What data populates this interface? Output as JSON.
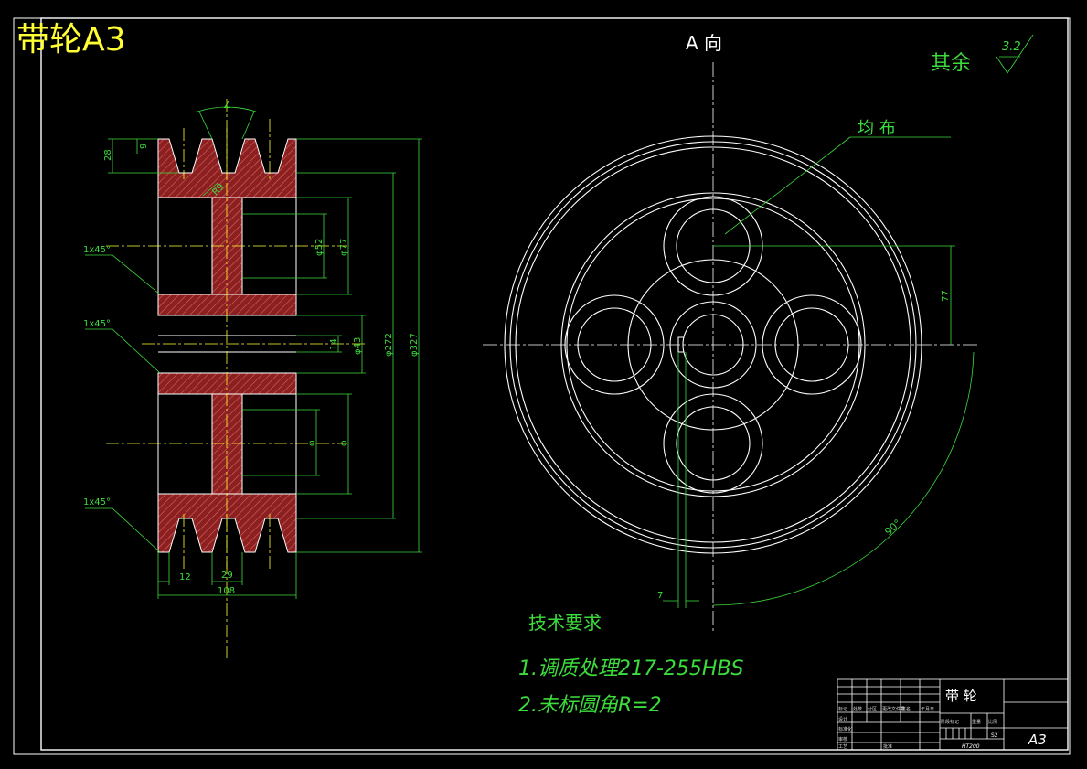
{
  "title": "带轮A3",
  "view_label": "A 向",
  "surface_roughness": {
    "label": "其余",
    "value": "3.2"
  },
  "distribution_label": "均 布",
  "section_dimensions": {
    "groove_angle": "∠",
    "groove_top": "9",
    "groove_depth": "28",
    "fillet": "R9",
    "chamfer_1": "1x45°",
    "chamfer_2": "1x45°",
    "chamfer_3": "1x45°",
    "bore_inner": "φ52",
    "bore_outer": "φ77",
    "keyway": "14",
    "shaft": "φ43",
    "hole_circle": "φ272",
    "outer_diameter": "φ327",
    "lower_dim_1": "φ",
    "lower_dim_2": "φ",
    "edge_width": "12",
    "groove_pitch": "29",
    "total_width": "108"
  },
  "view_dimensions": {
    "hole_offset": "77",
    "key_offset": "7",
    "angle": "90°"
  },
  "tech_requirements": {
    "heading": "技术要求",
    "items": [
      "1.调质处理217-255HBS",
      "2.未标圆角R=2"
    ]
  },
  "title_block": {
    "part_name": "带 轮",
    "material": "HT200",
    "sheet_size": "A3",
    "scale_marker": "S2",
    "header_cells": [
      "标记",
      "处数",
      "分区",
      "更改文件号",
      "签名",
      "年月日"
    ],
    "row_labels": [
      "设计",
      "审核",
      "工艺"
    ],
    "stage_labels": [
      "阶段标记",
      "重量",
      "比例"
    ],
    "approve_label": "批准",
    "standardize_label": "标准化"
  },
  "colors": {
    "frame": "#ffffff",
    "outline": "#ffffff",
    "dimension": "#3cdc3c",
    "centerline": "#ffff33",
    "hatch": "#c84646",
    "title": "#ffff33"
  }
}
